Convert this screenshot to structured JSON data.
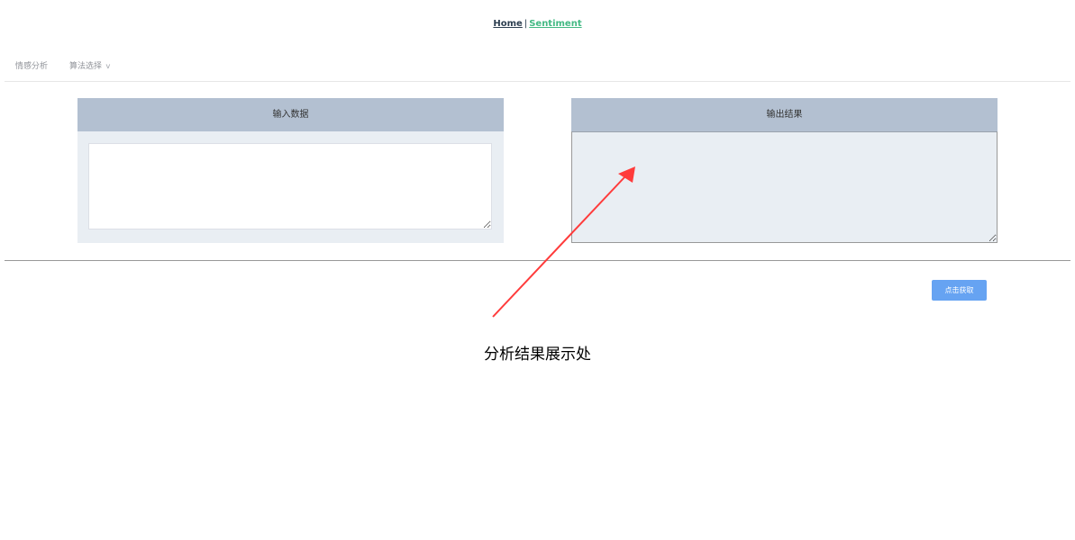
{
  "topnav": {
    "home_label": "Home",
    "separator": "|",
    "sentiment_label": "Sentiment"
  },
  "menu": {
    "items": [
      {
        "label": "情感分析"
      },
      {
        "label": "算法选择",
        "has_dropdown": true
      }
    ],
    "dropdown_icon": "chevron-down-icon"
  },
  "input_panel": {
    "title": "输入数据",
    "value": "",
    "placeholder": ""
  },
  "output_panel": {
    "title": "输出结果",
    "value": ""
  },
  "fetch_button": {
    "label": "点击获取"
  },
  "annotation": {
    "text": "分析结果展示处",
    "arrow_color": "#ff3b3b"
  },
  "colors": {
    "header_bg": "#b3c0d1",
    "body_bg": "#e9eef3",
    "button_bg": "#66a3f2",
    "link_active": "#42b983",
    "link_default": "#2c3e50"
  }
}
